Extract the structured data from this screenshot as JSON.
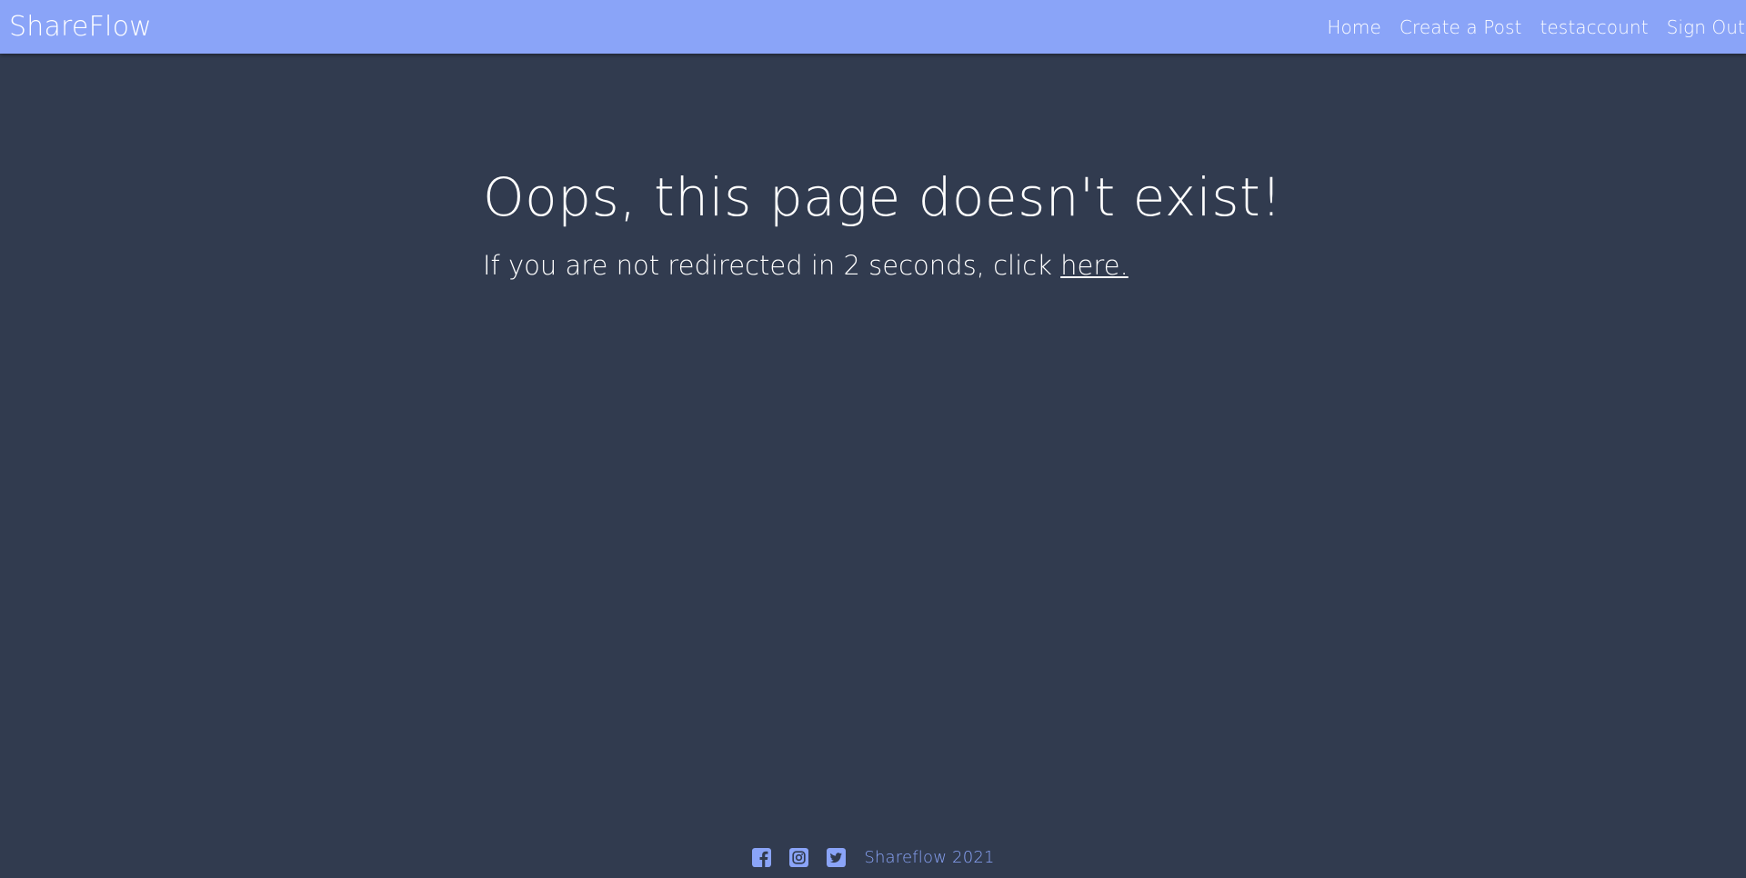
{
  "navbar": {
    "brand": "ShareFlow",
    "links": [
      {
        "label": "Home"
      },
      {
        "label": "Create a Post"
      },
      {
        "label": "testaccount"
      },
      {
        "label": "Sign Out"
      }
    ]
  },
  "main": {
    "headline": "Oops, this page doesn't exist!",
    "redirect_text": "If you are not redirected in 2 seconds, click ",
    "redirect_link": "here."
  },
  "footer": {
    "icons": [
      "facebook-icon",
      "instagram-icon",
      "twitter-icon"
    ],
    "copyright": "Shareflow 2021"
  },
  "colors": {
    "background": "#313b4f",
    "navbar": "#8aa4f8",
    "accent": "#8aa4f8",
    "text": "#ffffff"
  }
}
